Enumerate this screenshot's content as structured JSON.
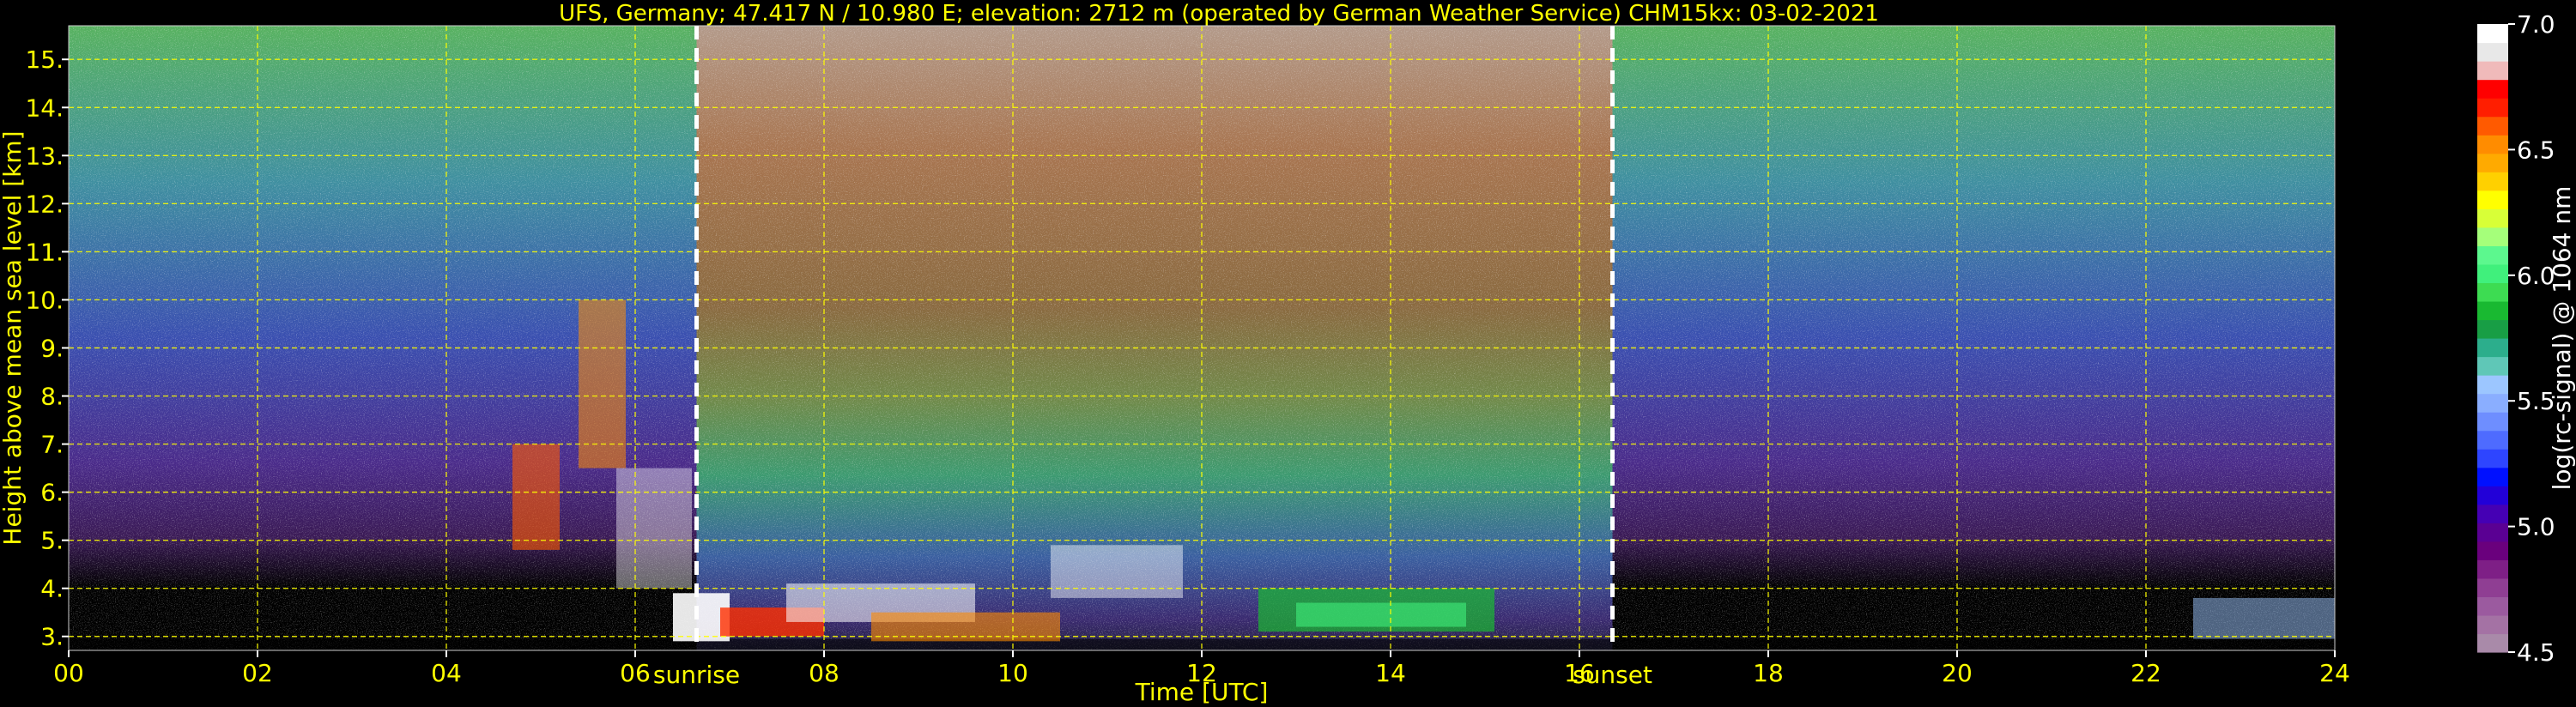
{
  "chart_data": {
    "type": "heatmap",
    "title": "UFS, Germany; 47.417 N / 10.980 E; elevation: 2712 m  (operated by German Weather Service)    CHM15kx: 03-02-2021",
    "xlabel": "Time [UTC]",
    "ylabel": "Height above mean sea level [km]",
    "xlim": [
      0,
      24
    ],
    "ylim": [
      2.71,
      15.7
    ],
    "x_ticks": [
      {
        "value": 0,
        "label": "00"
      },
      {
        "value": 2,
        "label": "02"
      },
      {
        "value": 4,
        "label": "04"
      },
      {
        "value": 6,
        "label": "06"
      },
      {
        "value": 8,
        "label": "08"
      },
      {
        "value": 10,
        "label": "10"
      },
      {
        "value": 12,
        "label": "12"
      },
      {
        "value": 14,
        "label": "14"
      },
      {
        "value": 16,
        "label": "16"
      },
      {
        "value": 18,
        "label": "18"
      },
      {
        "value": 20,
        "label": "20"
      },
      {
        "value": 22,
        "label": "22"
      },
      {
        "value": 24,
        "label": "24"
      }
    ],
    "y_ticks": [
      {
        "value": 3,
        "label": "3."
      },
      {
        "value": 4,
        "label": "4."
      },
      {
        "value": 5,
        "label": "5."
      },
      {
        "value": 6,
        "label": "6."
      },
      {
        "value": 7,
        "label": "7."
      },
      {
        "value": 8,
        "label": "8."
      },
      {
        "value": 9,
        "label": "9."
      },
      {
        "value": 10,
        "label": "10."
      },
      {
        "value": 11,
        "label": "11."
      },
      {
        "value": 12,
        "label": "12."
      },
      {
        "value": 13,
        "label": "13."
      },
      {
        "value": 14,
        "label": "14."
      },
      {
        "value": 15,
        "label": "15."
      }
    ],
    "grid": true,
    "annotations": [
      {
        "text": "sunrise",
        "x": 6.65
      },
      {
        "text": "sunset",
        "x": 16.35
      }
    ],
    "colorbar": {
      "label": "log(rc-signal) @ 1064 nm",
      "range": [
        4.5,
        7.0
      ],
      "ticks": [
        {
          "value": 4.5,
          "label": "4.5"
        },
        {
          "value": 5.0,
          "label": "5.0"
        },
        {
          "value": 5.5,
          "label": "5.5"
        },
        {
          "value": 6.0,
          "label": "6.0"
        },
        {
          "value": 6.5,
          "label": "6.5"
        },
        {
          "value": 7.0,
          "label": "7.0"
        }
      ],
      "colors": [
        "#A98AA9",
        "#A472A4",
        "#9B5A9F",
        "#8F3E93",
        "#7E1F86",
        "#6A007D",
        "#5A0093",
        "#4500B4",
        "#2200D8",
        "#0010FF",
        "#2E45FF",
        "#4E6BFF",
        "#6E8EFF",
        "#8AAEFF",
        "#9CC6FF",
        "#5FC7B7",
        "#2CAE8C",
        "#189E45",
        "#19B931",
        "#3DDC52",
        "#40F07C",
        "#5CF88E",
        "#A5FF7A",
        "#D8FF37",
        "#FFFF00",
        "#FFD000",
        "#FFAA00",
        "#FF8C00",
        "#FF5A00",
        "#FF1E00",
        "#FF0000",
        "#F0BABA",
        "#E8E8E8",
        "#FFFFFF"
      ]
    }
  }
}
